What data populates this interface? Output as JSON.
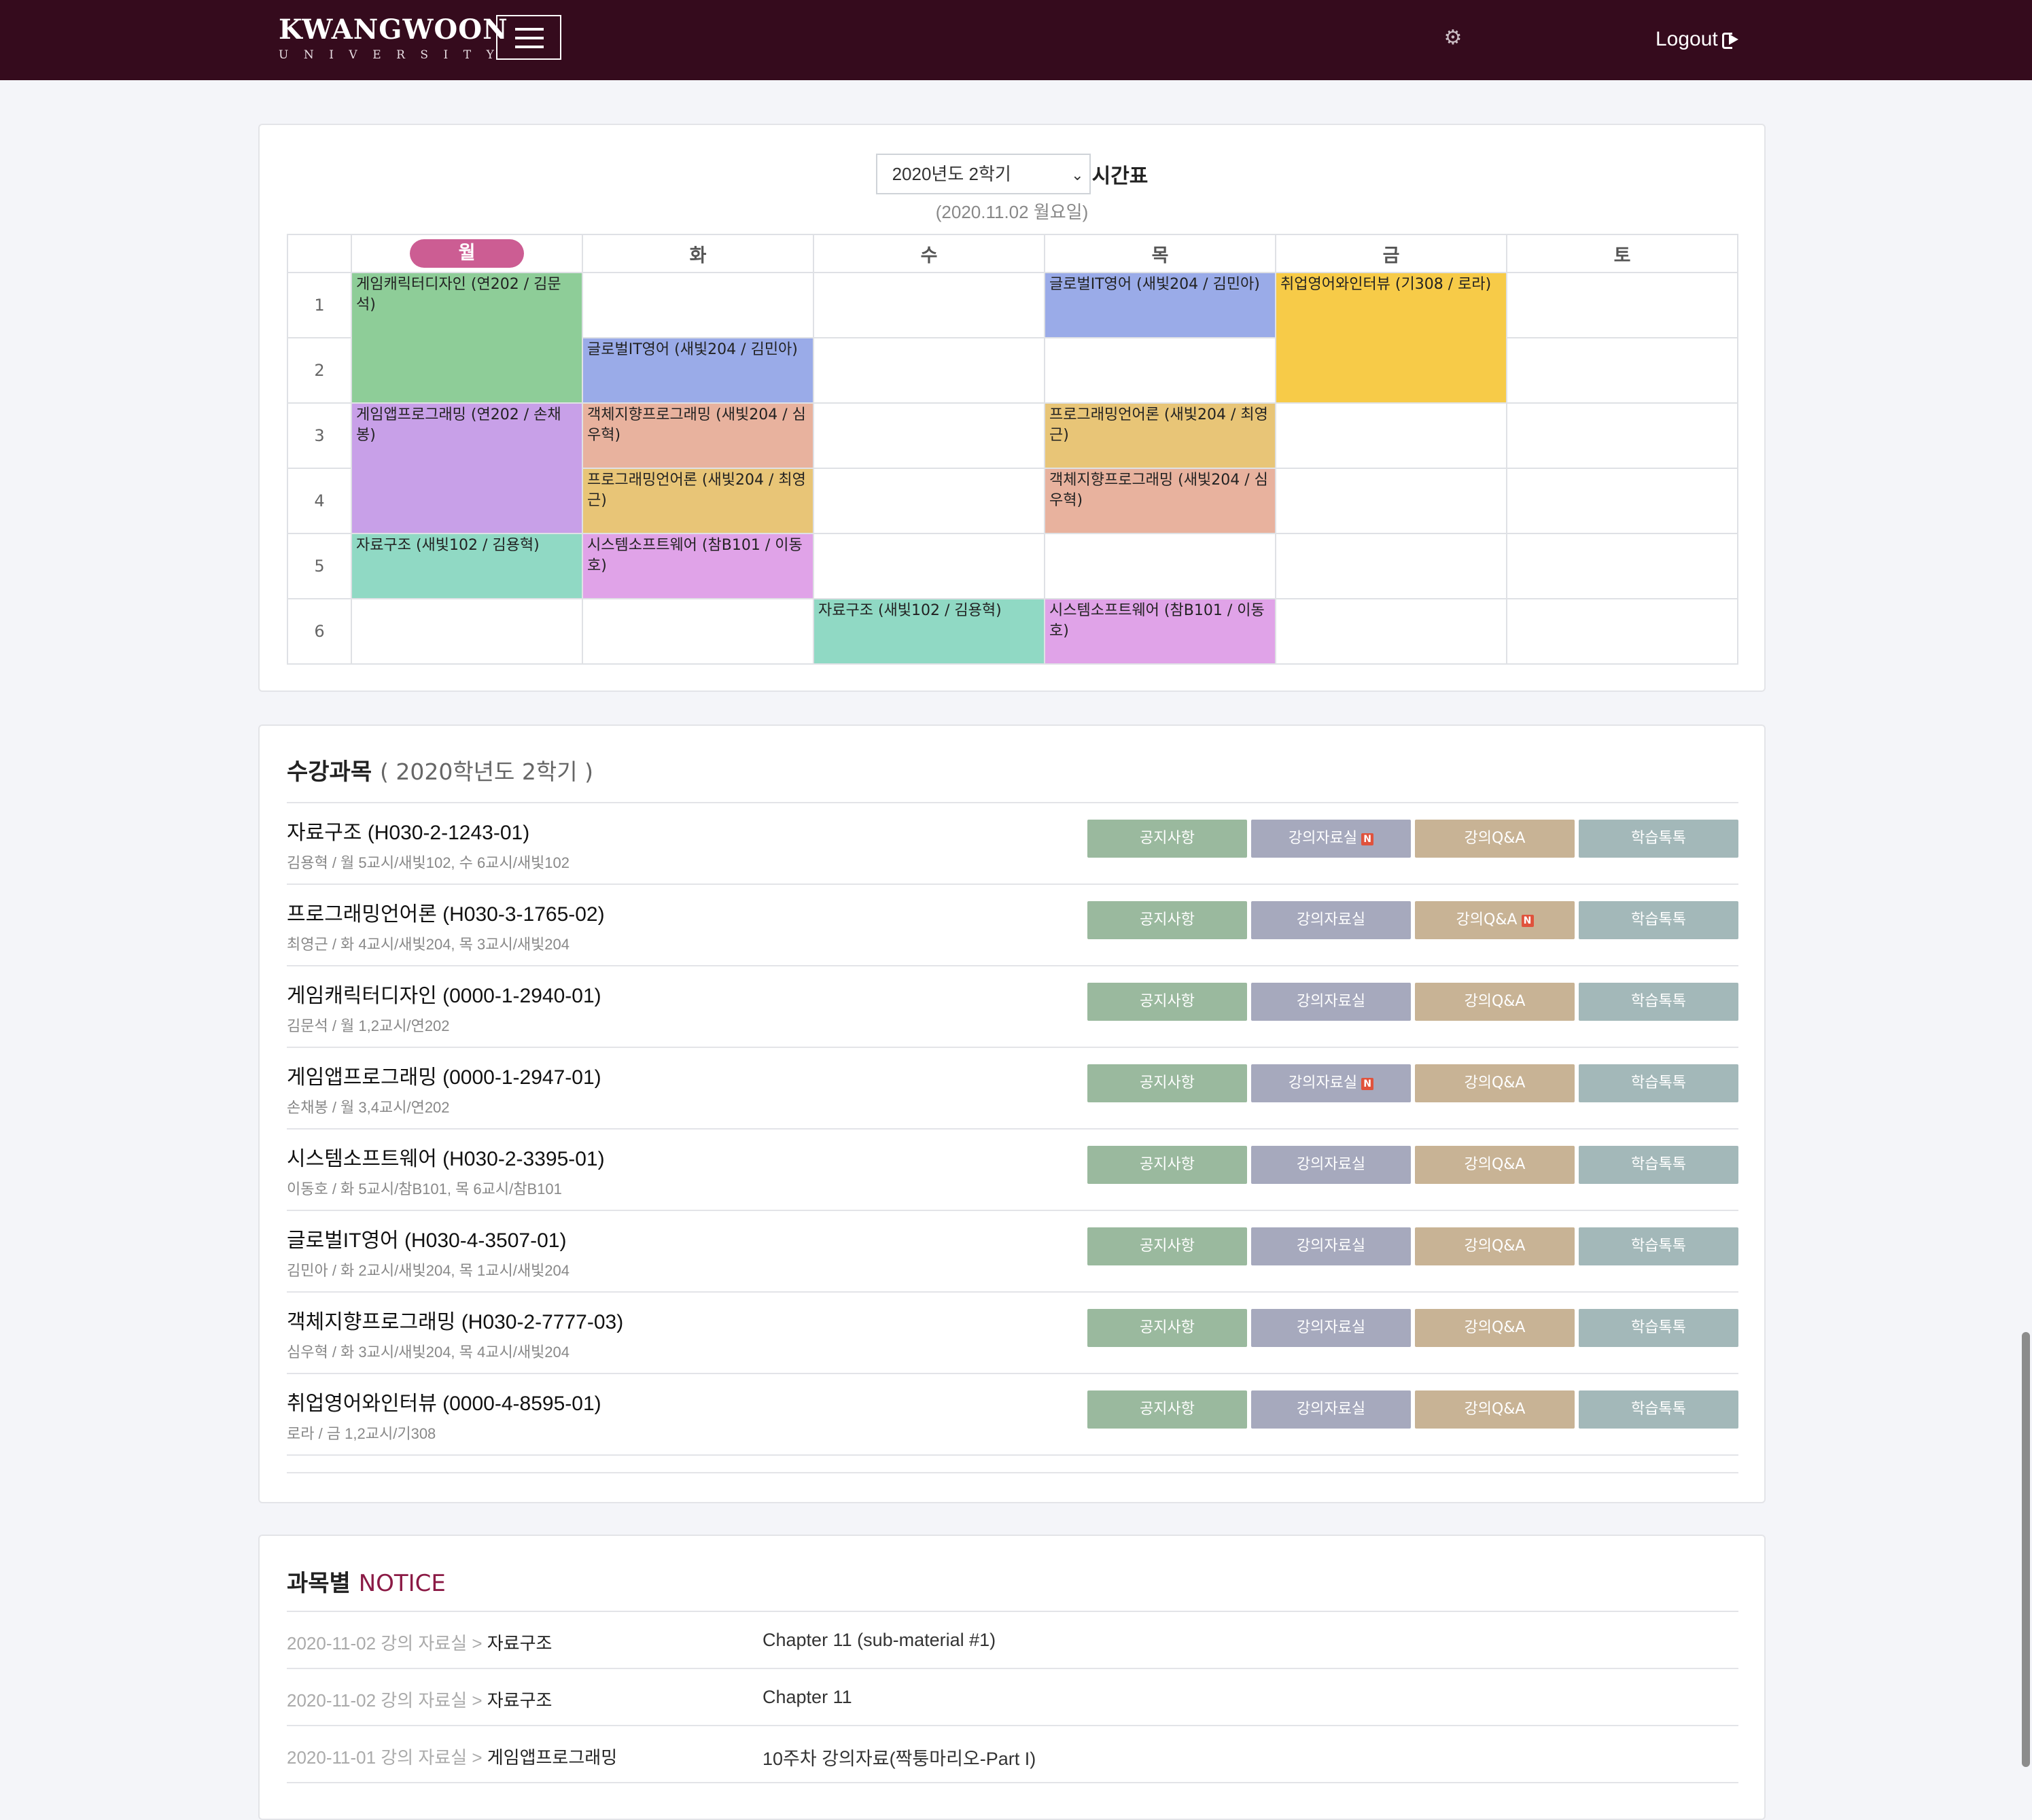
{
  "header": {
    "logo_main": "KWANGWOON",
    "logo_sub": "UNIVERSITY",
    "logout_label": "Logout"
  },
  "timetable": {
    "semester_select": "2020년도 2학기",
    "title": "시간표",
    "date": "(2020.11.02 월요일)",
    "days": [
      "월",
      "화",
      "수",
      "목",
      "금",
      "토"
    ],
    "active_day": "월",
    "periods": [
      "1",
      "2",
      "3",
      "4",
      "5",
      "6"
    ],
    "classes": {
      "mon_1": "게임캐릭터디자인 (연202 / 김문석)",
      "mon_3": "게임앱프로그래밍 (연202 / 손채봉)",
      "mon_5": "자료구조 (새빛102 / 김용혁)",
      "tue_2": "글로벌IT영어 (새빛204 / 김민아)",
      "tue_3": "객체지향프로그래밍 (새빛204 / 심우혁)",
      "tue_4": "프로그래밍언어론 (새빛204 / 최영근)",
      "tue_5": "시스템소프트웨어 (참B101 / 이동호)",
      "wed_6": "자료구조 (새빛102 / 김용혁)",
      "thu_1": "글로벌IT영어 (새빛204 / 김민아)",
      "thu_3": "프로그래밍언어론 (새빛204 / 최영근)",
      "thu_4": "객체지향프로그래밍 (새빛204 / 심우혁)",
      "thu_6": "시스템소프트웨어 (참B101 / 이동호)",
      "fri_1": "취업영어와인터뷰 (기308 / 로라)"
    },
    "colors": {
      "game_char": "#8ecd98",
      "game_app": "#c8a0e8",
      "data_struct": "#90d9c4",
      "global_it": "#9aabe8",
      "oop": "#e8b29e",
      "prog_lang": "#e8c577",
      "sys_sw": "#e0a3e8",
      "job_eng": "#f7cb48"
    }
  },
  "courses": {
    "title": "수강과목",
    "subtitle": "( 2020학년도 2학기 )",
    "btn_labels": {
      "notice": "공지사항",
      "materials": "강의자료실",
      "qa": "강의Q&A",
      "talk": "학습톡톡"
    },
    "new_badge": "N",
    "list": [
      {
        "name": "자료구조 (H030-2-1243-01)",
        "info": "김용혁 / 월 5교시/새빛102, 수 6교시/새빛102"
      },
      {
        "name": "프로그래밍언어론 (H030-3-1765-02)",
        "info": "최영근 / 화 4교시/새빛204, 목 3교시/새빛204"
      },
      {
        "name": "게임캐릭터디자인 (0000-1-2940-01)",
        "info": "김문석 / 월 1,2교시/연202"
      },
      {
        "name": "게임앱프로그래밍 (0000-1-2947-01)",
        "info": "손채봉 / 월 3,4교시/연202"
      },
      {
        "name": "시스템소프트웨어 (H030-2-3395-01)",
        "info": "이동호 / 화 5교시/참B101, 목 6교시/참B101"
      },
      {
        "name": "글로벌IT영어 (H030-4-3507-01)",
        "info": "김민아 / 화 2교시/새빛204, 목 1교시/새빛204"
      },
      {
        "name": "객체지향프로그래밍 (H030-2-7777-03)",
        "info": "심우혁 / 화 3교시/새빛204, 목 4교시/새빛204"
      },
      {
        "name": "취업영어와인터뷰 (0000-4-8595-01)",
        "info": "로라 / 금 1,2교시/기308"
      }
    ]
  },
  "notice": {
    "title": "과목별",
    "title_accent": "NOTICE",
    "items": [
      {
        "meta": "2020-11-02 강의 자료실 > ",
        "course": "자료구조",
        "title": "Chapter 11 (sub-material #1)"
      },
      {
        "meta": "2020-11-02 강의 자료실 > ",
        "course": "자료구조",
        "title": "Chapter 11"
      },
      {
        "meta": "2020-11-01 강의 자료실 > ",
        "course": "게임앱프로그래밍",
        "title": "10주차 강의자료(짝퉁마리오-Part I)"
      }
    ]
  }
}
